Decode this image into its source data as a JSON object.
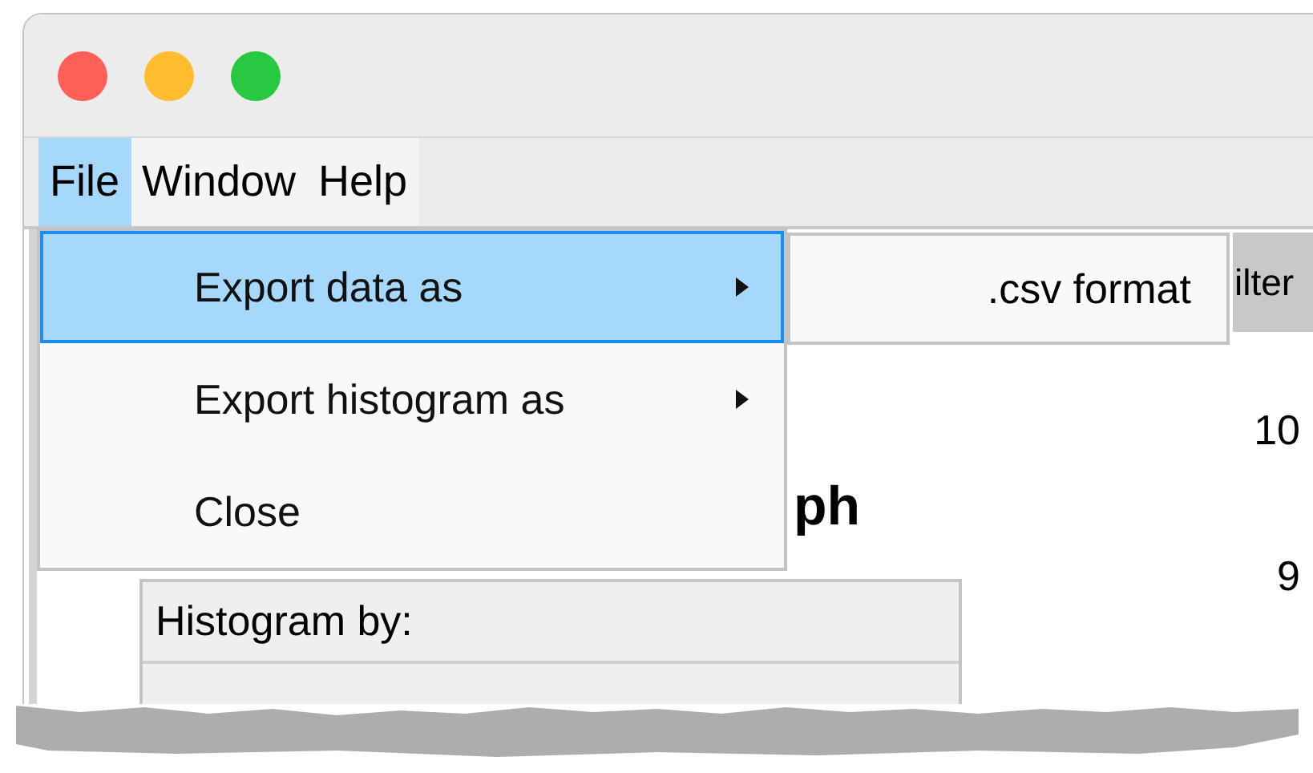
{
  "window": {
    "traffic_lights": [
      {
        "color": "#fe5f57"
      },
      {
        "color": "#febc2e"
      },
      {
        "color": "#28c840"
      }
    ]
  },
  "menubar": [
    {
      "label": "File",
      "selected": true
    },
    {
      "label": "Window",
      "selected": false
    },
    {
      "label": "Help",
      "selected": false
    }
  ],
  "menu": {
    "items": [
      {
        "label": "Export data as",
        "has_submenu": true,
        "selected": true
      },
      {
        "label": "Export histogram as",
        "has_submenu": true,
        "selected": false
      },
      {
        "label": "Close",
        "has_submenu": false,
        "selected": false
      }
    ]
  },
  "submenu": {
    "items": [
      {
        "label": ".csv format"
      }
    ]
  },
  "content": {
    "tab_fragment": "ilter",
    "heading_fragment": "ph",
    "axis_labels": [
      "10",
      "9"
    ],
    "panel": {
      "title": "Histogram by:"
    }
  }
}
